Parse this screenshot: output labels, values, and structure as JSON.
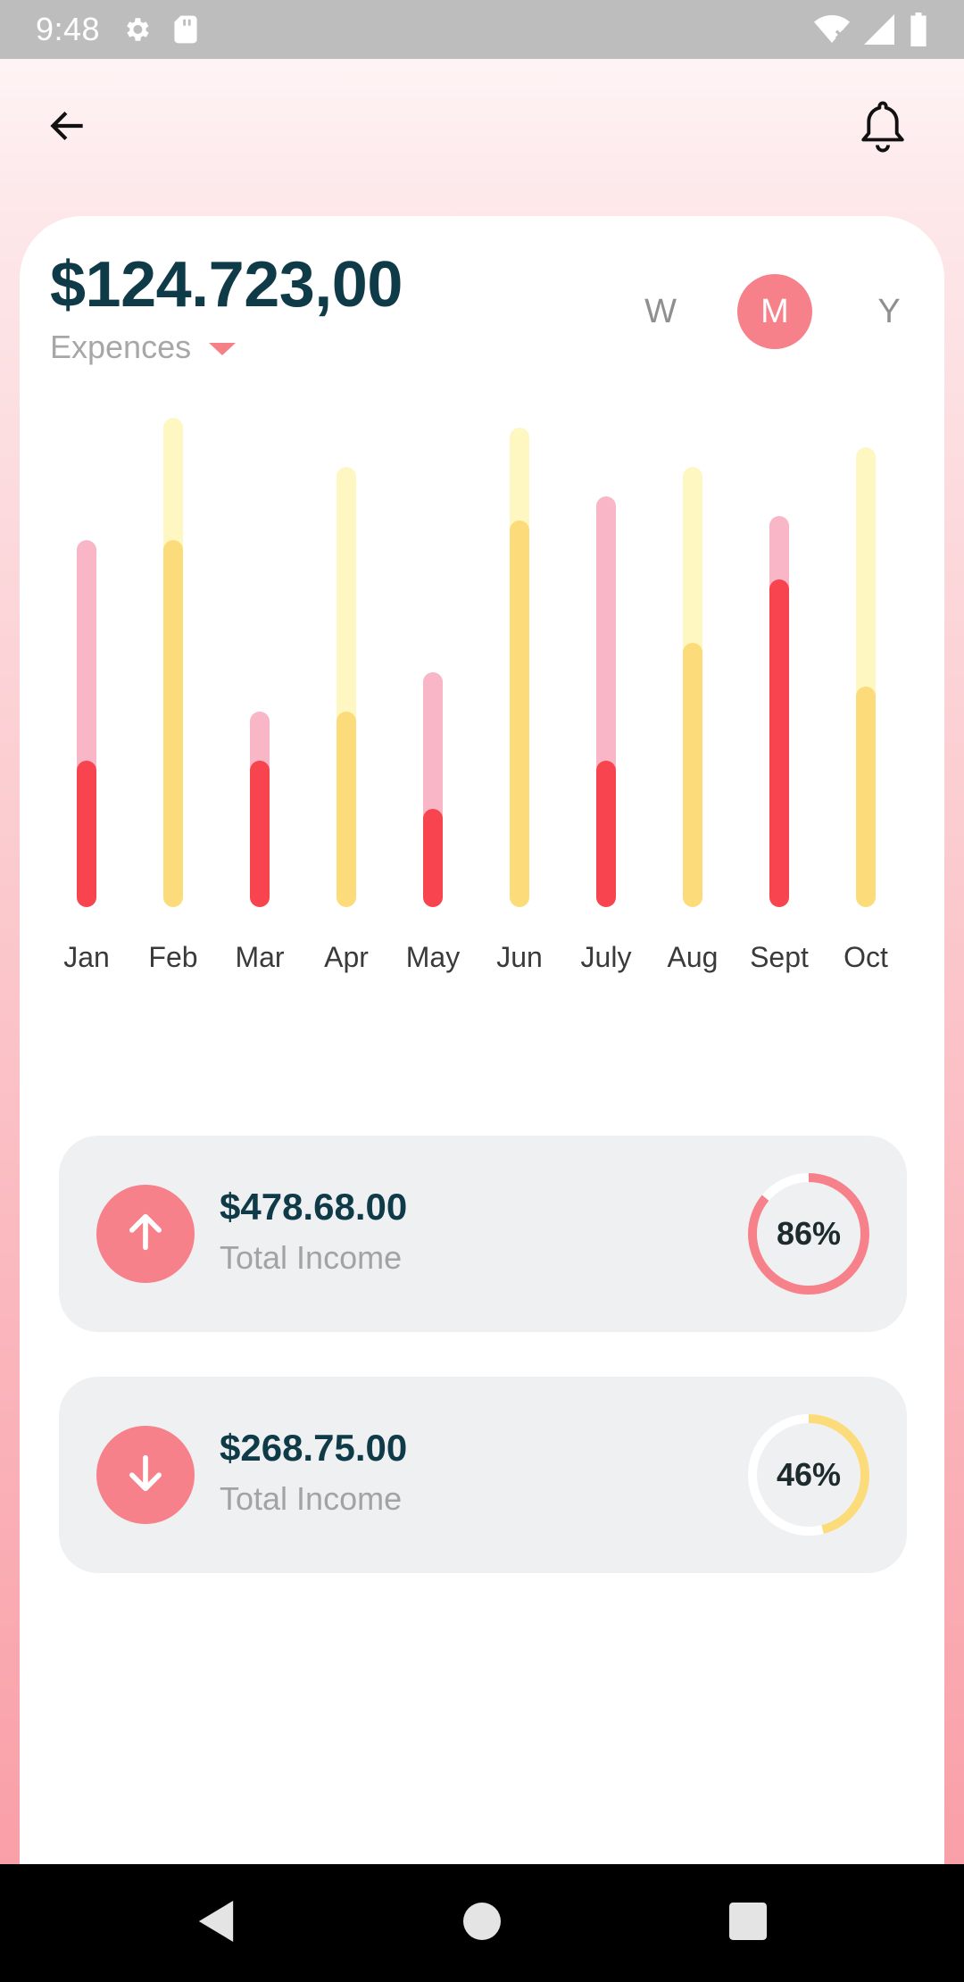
{
  "status_bar": {
    "time": "9:48",
    "icons": [
      "settings-icon",
      "sd-card-icon",
      "wifi-icon",
      "signal-icon",
      "battery-icon"
    ]
  },
  "header": {
    "back_icon": "arrow-left-icon",
    "notification_icon": "bell-icon"
  },
  "summary": {
    "amount": "$124.723,00",
    "category": "Expences",
    "dropdown_icon": "caret-down-icon"
  },
  "period_toggle": {
    "options": [
      "W",
      "M",
      "Y"
    ],
    "selected": "M"
  },
  "colors": {
    "accent": "#f7818a",
    "dark_text": "#0f3a47",
    "red_fill": "#f7444f",
    "red_track": "#f8b6c6",
    "yellow_fill": "#fbdb7a",
    "yellow_track": "#fef7c2"
  },
  "chart_data": {
    "type": "bar",
    "categories": [
      "Jan",
      "Feb",
      "Mar",
      "Apr",
      "May",
      "Jun",
      "July",
      "Aug",
      "Sept",
      "Oct"
    ],
    "series": [
      {
        "values": [
          0.3,
          0.75,
          0.3,
          0.4,
          0.2,
          0.79,
          0.3,
          0.54,
          0.67,
          0.45
        ]
      },
      {
        "values": [
          0.75,
          1.0,
          0.4,
          0.9,
          0.48,
          0.98,
          0.84,
          0.9,
          0.8,
          0.94
        ]
      }
    ],
    "bar_colors": [
      "red",
      "yellow",
      "red",
      "yellow",
      "red",
      "yellow",
      "red",
      "yellow",
      "red",
      "yellow"
    ],
    "grid": false
  },
  "stats": [
    {
      "direction_icon": "arrow-up-icon",
      "value": "$478.68.00",
      "label": "Total Income",
      "percent": 86,
      "percent_label": "86%",
      "ring_color": "#f7818a"
    },
    {
      "direction_icon": "arrow-down-icon",
      "value": "$268.75.00",
      "label": "Total Income",
      "percent": 46,
      "percent_label": "46%",
      "ring_color": "#fbdb7a"
    }
  ],
  "nav_bar": {
    "icons": [
      "back-triangle-icon",
      "home-circle-icon",
      "recents-square-icon"
    ]
  }
}
